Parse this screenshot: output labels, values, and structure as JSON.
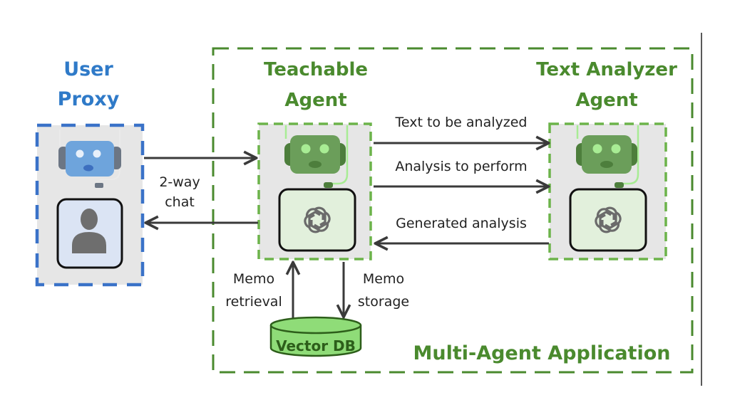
{
  "user_proxy": {
    "title_line1": "User",
    "title_line2": "Proxy",
    "color": "#2f7ac8"
  },
  "teachable_agent": {
    "title_line1": "Teachable",
    "title_line2": "Agent"
  },
  "text_analyzer_agent": {
    "title_line1": "Text Analyzer",
    "title_line2": "Agent"
  },
  "container": {
    "label": "Multi-Agent Application",
    "color": "#4a8a2e"
  },
  "chat": {
    "line1": "2-way",
    "line2": "chat"
  },
  "messages": {
    "text_to_analyze": "Text to be analyzed",
    "analysis_to_perform": "Analysis to perform",
    "generated_analysis": "Generated analysis"
  },
  "memo": {
    "retrieval_line1": "Memo",
    "retrieval_line2": "retrieval",
    "storage_line1": "Memo",
    "storage_line2": "storage"
  },
  "vector_db": {
    "label": "Vector DB",
    "color": "#8fdc78"
  },
  "icons": {
    "user_robot": "robot-icon",
    "user_person": "person-icon",
    "agent_robot": "robot-icon",
    "llm": "openai-logo-icon",
    "database": "database-icon"
  }
}
